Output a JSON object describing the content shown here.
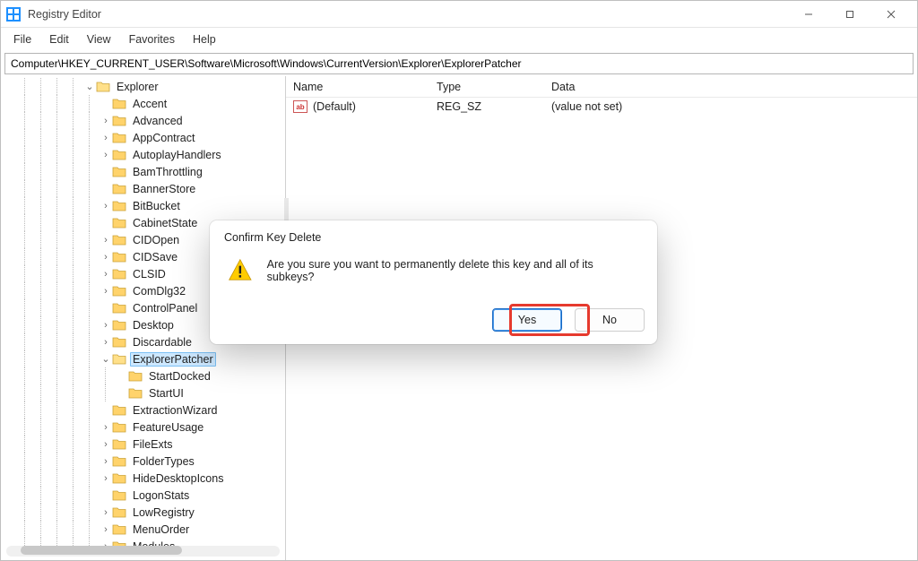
{
  "titlebar": {
    "app_name": "Registry Editor"
  },
  "menubar": {
    "items": [
      "File",
      "Edit",
      "View",
      "Favorites",
      "Help"
    ]
  },
  "address": "Computer\\HKEY_CURRENT_USER\\Software\\Microsoft\\Windows\\CurrentVersion\\Explorer\\ExplorerPatcher",
  "tree": {
    "root_label": "Explorer",
    "items": [
      {
        "label": "Accent",
        "expander": "none"
      },
      {
        "label": "Advanced",
        "expander": "closed"
      },
      {
        "label": "AppContract",
        "expander": "closed"
      },
      {
        "label": "AutoplayHandlers",
        "expander": "closed"
      },
      {
        "label": "BamThrottling",
        "expander": "none"
      },
      {
        "label": "BannerStore",
        "expander": "none"
      },
      {
        "label": "BitBucket",
        "expander": "closed"
      },
      {
        "label": "CabinetState",
        "expander": "none"
      },
      {
        "label": "CIDOpen",
        "expander": "closed"
      },
      {
        "label": "CIDSave",
        "expander": "closed"
      },
      {
        "label": "CLSID",
        "expander": "closed"
      },
      {
        "label": "ComDlg32",
        "expander": "closed"
      },
      {
        "label": "ControlPanel",
        "expander": "none"
      },
      {
        "label": "Desktop",
        "expander": "closed"
      },
      {
        "label": "Discardable",
        "expander": "closed"
      },
      {
        "label": "ExplorerPatcher",
        "expander": "open",
        "selected": true,
        "children": [
          {
            "label": "StartDocked",
            "expander": "none"
          },
          {
            "label": "StartUI",
            "expander": "none"
          }
        ]
      },
      {
        "label": "ExtractionWizard",
        "expander": "none"
      },
      {
        "label": "FeatureUsage",
        "expander": "closed"
      },
      {
        "label": "FileExts",
        "expander": "closed"
      },
      {
        "label": "FolderTypes",
        "expander": "closed"
      },
      {
        "label": "HideDesktopIcons",
        "expander": "closed"
      },
      {
        "label": "LogonStats",
        "expander": "none"
      },
      {
        "label": "LowRegistry",
        "expander": "closed"
      },
      {
        "label": "MenuOrder",
        "expander": "closed"
      },
      {
        "label": "Modules",
        "expander": "closed"
      }
    ]
  },
  "columns": {
    "name": "Name",
    "type": "Type",
    "data": "Data"
  },
  "values": [
    {
      "name": "(Default)",
      "type": "REG_SZ",
      "data": "(value not set)",
      "icon": "ab"
    }
  ],
  "dialog": {
    "title": "Confirm Key Delete",
    "message": "Are you sure you want to permanently delete this key and all of its subkeys?",
    "yes": "Yes",
    "no": "No"
  }
}
